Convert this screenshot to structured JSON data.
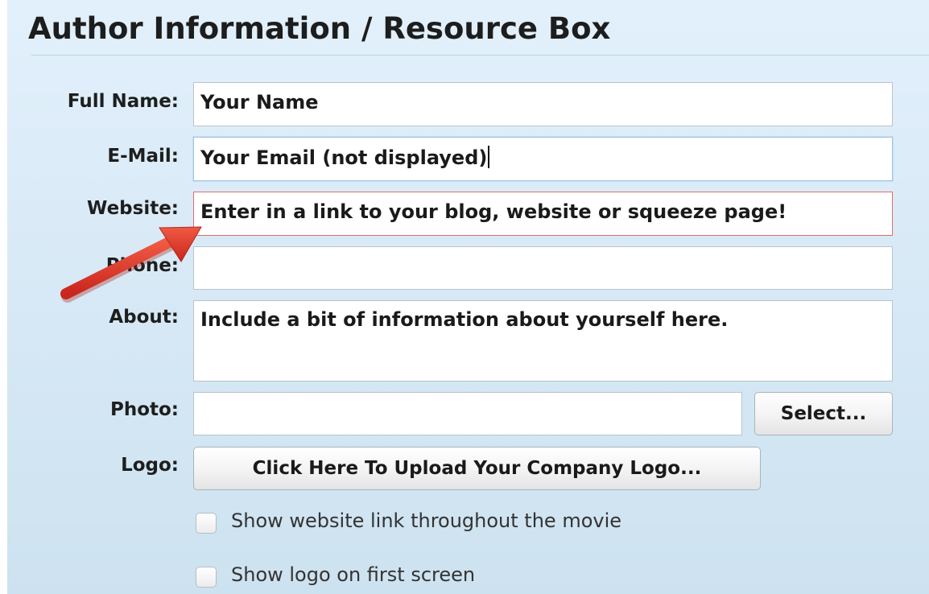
{
  "section": {
    "title": "Author Information / Resource Box"
  },
  "form": {
    "full_name": {
      "label": "Full Name:",
      "value": "Your Name"
    },
    "email": {
      "label": "E-Mail:",
      "value": "Your Email (not displayed)"
    },
    "website": {
      "label": "Website:",
      "value": "Enter in a link to your blog, website or squeeze page!"
    },
    "phone": {
      "label": "Phone:",
      "value": ""
    },
    "about": {
      "label": "About:",
      "value": "Include a bit of information about yourself here."
    },
    "photo": {
      "label": "Photo:",
      "value": "",
      "select_label": "Select..."
    },
    "logo": {
      "label": "Logo:",
      "upload_label": "Click Here To Upload Your Company Logo..."
    },
    "checkboxes": [
      {
        "label": "Show website link throughout the movie",
        "checked": false
      },
      {
        "label": "Show logo on first screen",
        "checked": false
      }
    ]
  },
  "annotation": {
    "icon": "red-arrow-icon",
    "color": "#e0382c"
  },
  "colors": {
    "error_border": "#e46b6b",
    "background": "#d6e8f5"
  }
}
